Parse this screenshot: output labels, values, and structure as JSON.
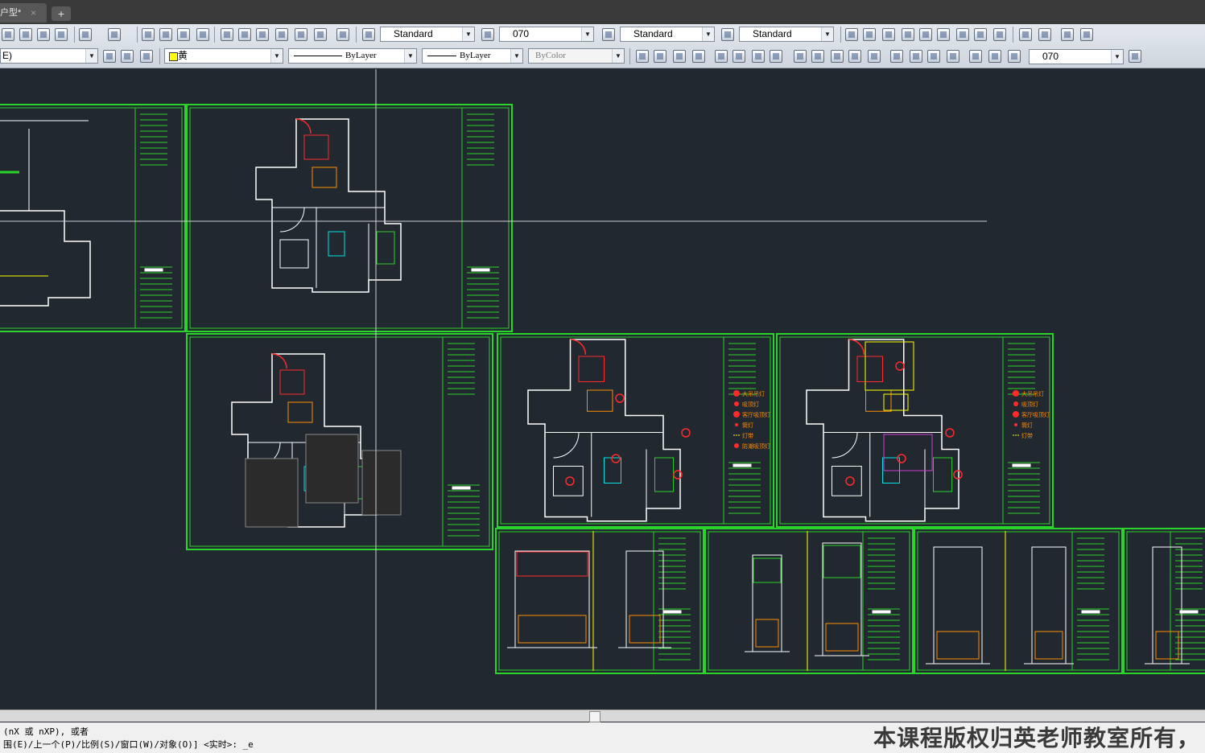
{
  "tab": {
    "title": "户型*",
    "close": "×",
    "new": "+"
  },
  "toolbar_row1": {
    "text_style": "Standard",
    "dim_style": "070",
    "table_style": "Standard",
    "mleader_style": "Standard"
  },
  "toolbar_row2": {
    "layer": "E)",
    "color": "黄",
    "linetype": "ByLayer",
    "lineweight": "ByLayer",
    "plotstyle": "ByColor",
    "dim_style": "070"
  },
  "command": {
    "line1": "(nX 或 nXP), 或者",
    "line2": "围(E)/上一个(P)/比例(S)/窗口(W)/对象(O)] <实时>: _e"
  },
  "watermark": "本课程版权归英老师教室所有，",
  "legend_labels": [
    "大吊吊灯",
    "吸顶灯",
    "客厅吸顶灯",
    "筒灯",
    "灯带",
    "防潮吸顶灯"
  ],
  "colors": {
    "frame": "#2ad42a",
    "wall": "#ffffff",
    "door": "#ff2a2a",
    "furniture": "#ff8c00",
    "accent": "#ffff00",
    "cyan": "#00e5e5",
    "magenta": "#d040d0",
    "background": "#212830"
  }
}
